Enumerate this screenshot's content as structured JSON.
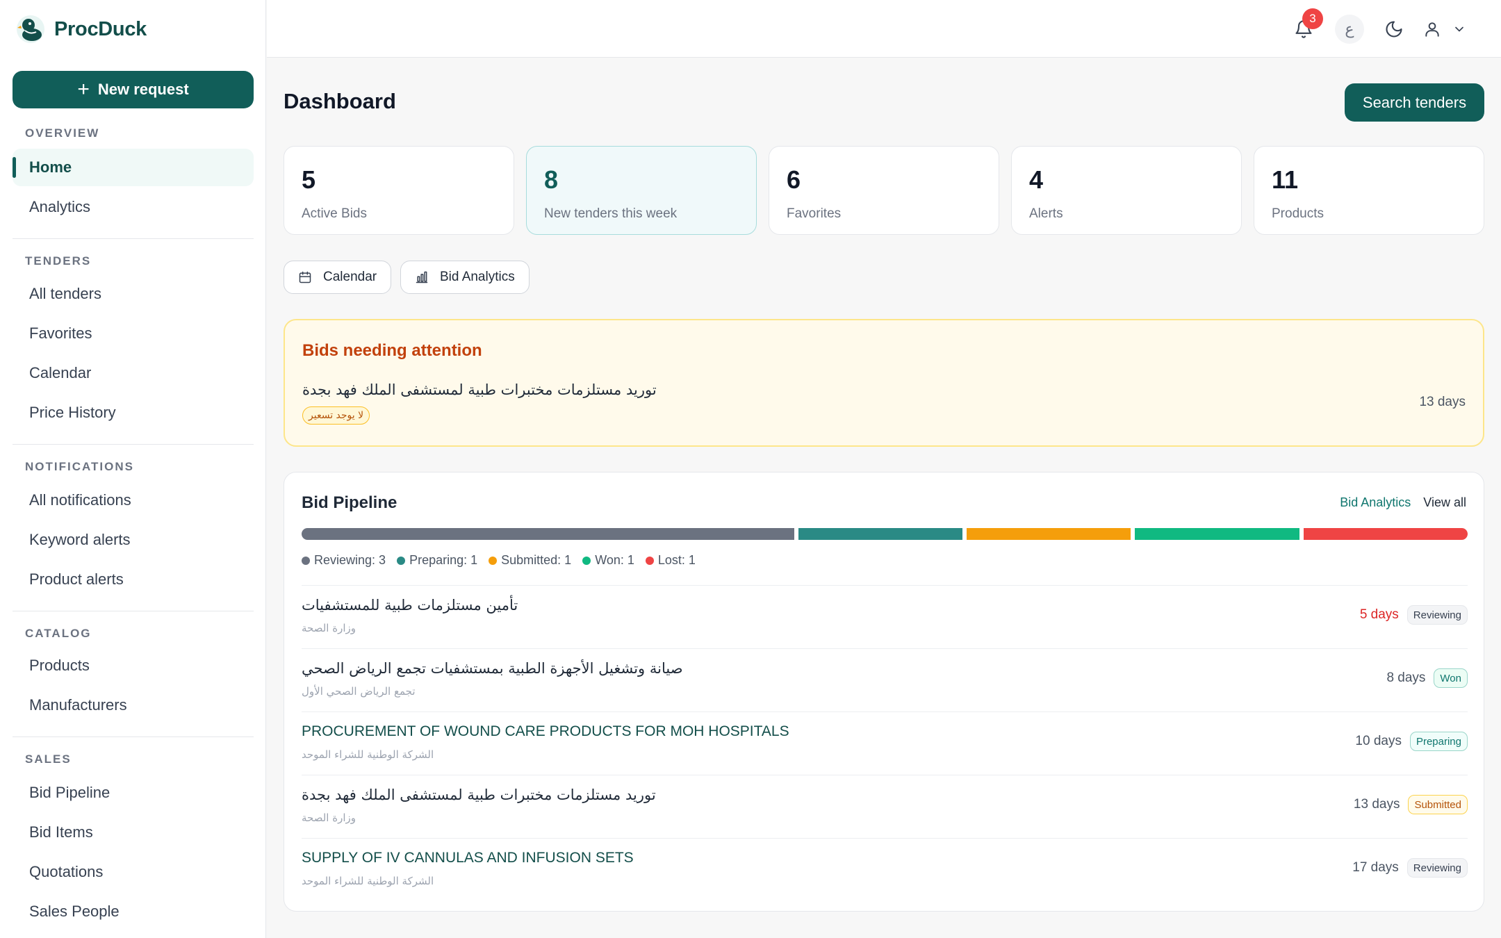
{
  "app": {
    "name": "ProcDuck"
  },
  "sidebar": {
    "new_request_label": "New request",
    "sections": [
      {
        "title": "OVERVIEW",
        "items": [
          {
            "label": "Home",
            "active": true
          },
          {
            "label": "Analytics"
          }
        ]
      },
      {
        "title": "TENDERS",
        "items": [
          {
            "label": "All tenders"
          },
          {
            "label": "Favorites"
          },
          {
            "label": "Calendar"
          },
          {
            "label": "Price History"
          }
        ]
      },
      {
        "title": "NOTIFICATIONS",
        "items": [
          {
            "label": "All notifications"
          },
          {
            "label": "Keyword alerts"
          },
          {
            "label": "Product alerts"
          }
        ]
      },
      {
        "title": "CATALOG",
        "items": [
          {
            "label": "Products"
          },
          {
            "label": "Manufacturers"
          }
        ]
      },
      {
        "title": "SALES",
        "items": [
          {
            "label": "Bid Pipeline"
          },
          {
            "label": "Bid Items"
          },
          {
            "label": "Quotations"
          },
          {
            "label": "Sales People"
          }
        ]
      }
    ]
  },
  "topbar": {
    "notification_count": "3",
    "language_label": "ع"
  },
  "main": {
    "title": "Dashboard",
    "search_button": "Search tenders",
    "stats": [
      {
        "value": "5",
        "label": "Active Bids"
      },
      {
        "value": "8",
        "label": "New tenders this week",
        "highlighted": true
      },
      {
        "value": "6",
        "label": "Favorites"
      },
      {
        "value": "4",
        "label": "Alerts"
      },
      {
        "value": "11",
        "label": "Products"
      }
    ],
    "quick_links": [
      {
        "label": "Calendar",
        "icon": "calendar-icon"
      },
      {
        "label": "Bid Analytics",
        "icon": "bar-chart-icon"
      }
    ]
  },
  "attention": {
    "title": "Bids needing attention",
    "items": [
      {
        "title": "توريد مستلزمات مختبرات طبية لمستشفى الملك فهد بجدة",
        "badge": "لا يوجد تسعير",
        "days": "13 days"
      }
    ]
  },
  "pipeline": {
    "title": "Bid Pipeline",
    "analytics_link": "Bid Analytics",
    "view_all_link": "View all",
    "stages": [
      {
        "name": "Reviewing",
        "count": 3,
        "color": "#6b7280",
        "legend": "Reviewing: 3"
      },
      {
        "name": "Preparing",
        "count": 1,
        "color": "#2a8a85",
        "legend": "Preparing: 1"
      },
      {
        "name": "Submitted",
        "count": 1,
        "color": "#f59e0b",
        "legend": "Submitted: 1"
      },
      {
        "name": "Won",
        "count": 1,
        "color": "#10b981",
        "legend": "Won: 1"
      },
      {
        "name": "Lost",
        "count": 1,
        "color": "#ef4444",
        "legend": "Lost: 1"
      }
    ],
    "rows": [
      {
        "title": "تأمين مستلزمات طبية للمستشفيات",
        "subtitle": "وزارة الصحة",
        "days": "5 days",
        "urgent": true,
        "status": "Reviewing",
        "status_class": "reviewing",
        "script": "ar"
      },
      {
        "title": "صيانة وتشغيل الأجهزة الطبية بمستشفيات تجمع الرياض الصحي",
        "subtitle": "تجمع الرياض الصحي الأول",
        "days": "8 days",
        "status": "Won",
        "status_class": "won",
        "script": "ar"
      },
      {
        "title": "PROCUREMENT OF WOUND CARE PRODUCTS FOR MOH HOSPITALS",
        "subtitle": "الشركة الوطنية للشراء الموحد",
        "days": "10 days",
        "status": "Preparing",
        "status_class": "preparing",
        "script": "en"
      },
      {
        "title": "توريد مستلزمات مختبرات طبية لمستشفى الملك فهد بجدة",
        "subtitle": "وزارة الصحة",
        "days": "13 days",
        "status": "Submitted",
        "status_class": "submitted",
        "script": "ar"
      },
      {
        "title": "SUPPLY OF IV CANNULAS AND INFUSION SETS",
        "subtitle": "الشركة الوطنية للشراء الموحد",
        "days": "17 days",
        "status": "Reviewing",
        "status_class": "reviewing",
        "script": "en"
      }
    ]
  }
}
